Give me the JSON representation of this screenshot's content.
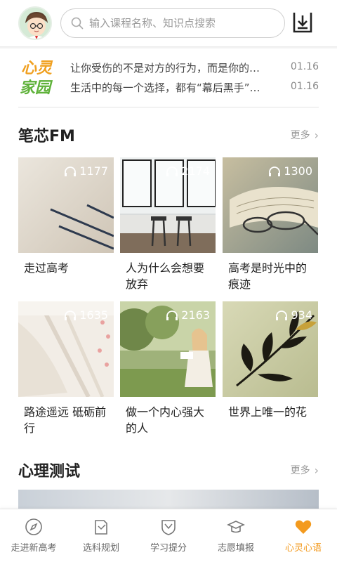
{
  "header": {
    "search_placeholder": "输入课程名称、知识点搜索"
  },
  "news": {
    "logo_top": "心灵",
    "logo_bottom": "家园",
    "items": [
      {
        "title": "让你受伤的不是对方的行为，而是你的…",
        "date": "01.16"
      },
      {
        "title": "生活中的每一个选择，都有“幕后黑手”…",
        "date": "01.16"
      }
    ]
  },
  "fm": {
    "title": "笔芯FM",
    "more": "更多",
    "cards": [
      {
        "count": "1177",
        "title": "走过高考"
      },
      {
        "count": "2174",
        "title": "人为什么会想要放弃"
      },
      {
        "count": "1300",
        "title": "高考是时光中的痕迹"
      },
      {
        "count": "1635",
        "title": "路途遥远 砥砺前行"
      },
      {
        "count": "2163",
        "title": "做一个内心强大的人"
      },
      {
        "count": "934",
        "title": "世界上唯一的花"
      }
    ]
  },
  "test": {
    "title": "心理测试",
    "more": "更多"
  },
  "tabs": [
    {
      "label": "走进新高考",
      "icon": "compass-icon"
    },
    {
      "label": "选科规划",
      "icon": "document-icon"
    },
    {
      "label": "学习提分",
      "icon": "shield-icon"
    },
    {
      "label": "志愿填报",
      "icon": "graduation-cap-icon"
    },
    {
      "label": "心灵心语",
      "icon": "heart-icon"
    }
  ],
  "colors": {
    "accent": "#f39a1e",
    "logo_orange": "#f0a020",
    "logo_green": "#5fb23a"
  }
}
